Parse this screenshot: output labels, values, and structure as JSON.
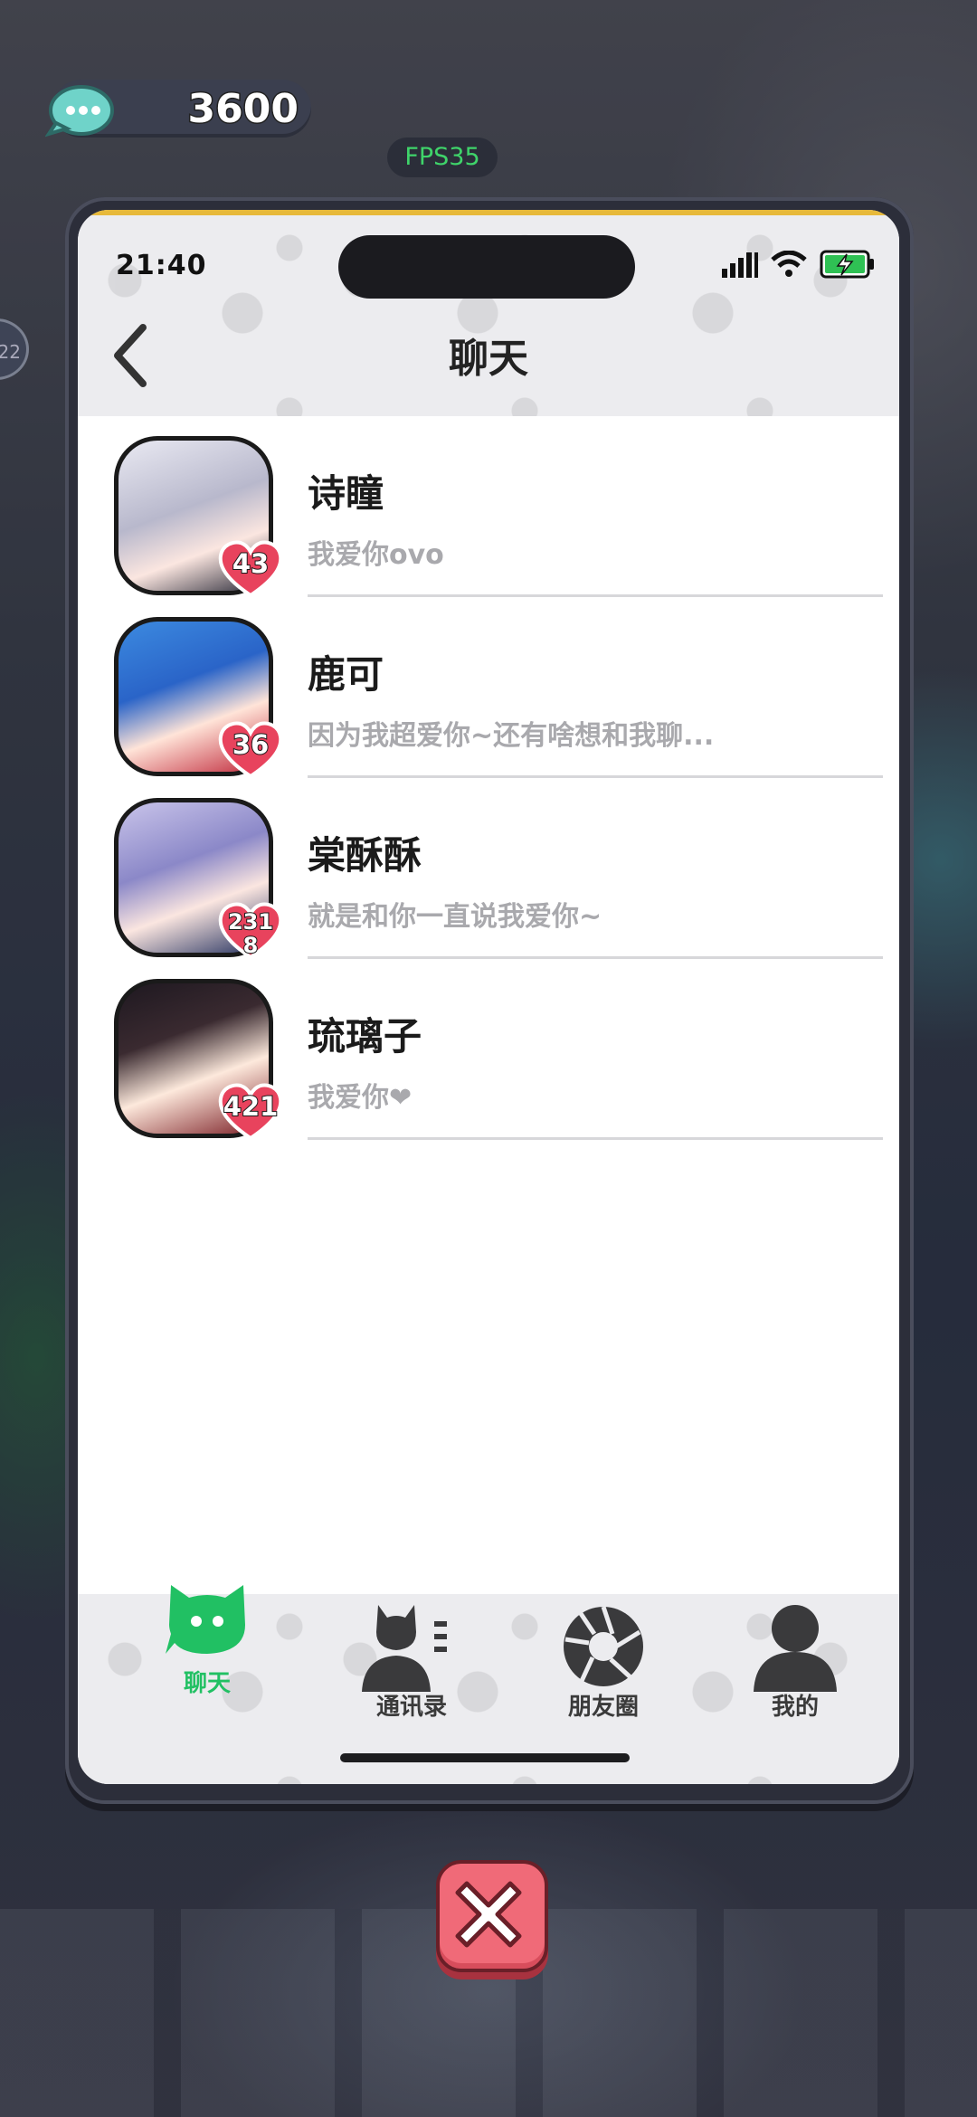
{
  "hud": {
    "coin_count": "3600",
    "fps": "FPS35",
    "side_badge": "22"
  },
  "status_bar": {
    "time": "21:40"
  },
  "header": {
    "title": "聊天"
  },
  "chats": [
    {
      "name": "诗瞳",
      "message": "我爱你ovo",
      "affection": "43",
      "avatar_color": "#b8b8cc"
    },
    {
      "name": "鹿可",
      "message": "因为我超爱你~还有啥想和我聊...",
      "affection": "36",
      "avatar_color": "#2a64c8"
    },
    {
      "name": "棠酥酥",
      "message": "就是和你一直说我爱你~",
      "affection": "2318",
      "avatar_color": "#8b88c8"
    },
    {
      "name": "琉璃子",
      "message": "我爱你❤",
      "affection": "421",
      "avatar_color": "#3a2a30"
    }
  ],
  "tabbar": {
    "tabs": [
      {
        "label": "聊天",
        "icon": "chat-cat-icon",
        "active": true
      },
      {
        "label": "通讯录",
        "icon": "contacts-icon",
        "active": false
      },
      {
        "label": "朋友圈",
        "icon": "aperture-icon",
        "active": false
      },
      {
        "label": "我的",
        "icon": "profile-icon",
        "active": false
      }
    ]
  },
  "colors": {
    "active_tab": "#21c063",
    "heart": "#e8435d",
    "close": "#f06a78"
  }
}
